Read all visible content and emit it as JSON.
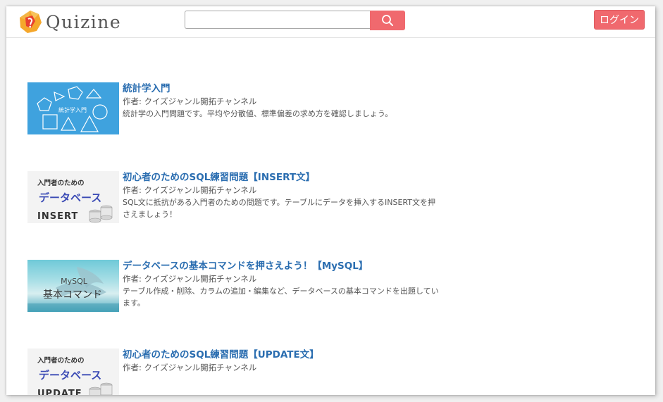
{
  "header": {
    "logo_text": "Quizine",
    "search": {
      "value": "",
      "placeholder": ""
    },
    "search_icon": "search-icon",
    "login_label": "ログイン"
  },
  "colors": {
    "accent": "#f0696e",
    "link": "#2a6db0",
    "text": "#555555"
  },
  "quizzes": [
    {
      "title": "統計学入門",
      "author": "作者: クイズジャンル開拓チャンネル",
      "description": "統計学の入門問題です。平均や分散値、標準偏差の求め方を確認しましょう。",
      "thumb": {
        "kind": "shapes",
        "label": "統計学入門"
      }
    },
    {
      "title": "初心者のためのSQL練習問題【INSERT文】",
      "author": "作者: クイズジャンル開拓チャンネル",
      "description": "SQL文に抵抗がある入門者のための問題です。テーブルにデータを挿入するINSERT文を押さえましょう！",
      "thumb": {
        "kind": "db",
        "line1": "入門者のための",
        "line2": "データベース",
        "line3": "INSERT"
      }
    },
    {
      "title": "データベースの基本コマンドを押さえよう！【MySQL】",
      "author": "作者: クイズジャンル開拓チャンネル",
      "description": "テーブル作成・削除、カラムの追加・編集など、データベースの基本コマンドを出題しています。",
      "thumb": {
        "kind": "mysql",
        "line1": "MySQL",
        "line2": "基本コマンド"
      }
    },
    {
      "title": "初心者のためのSQL練習問題【UPDATE文】",
      "author": "作者: クイズジャンル開拓チャンネル",
      "description": "",
      "thumb": {
        "kind": "db",
        "line1": "入門者のための",
        "line2": "データベース",
        "line3": "UPDATE"
      }
    }
  ]
}
